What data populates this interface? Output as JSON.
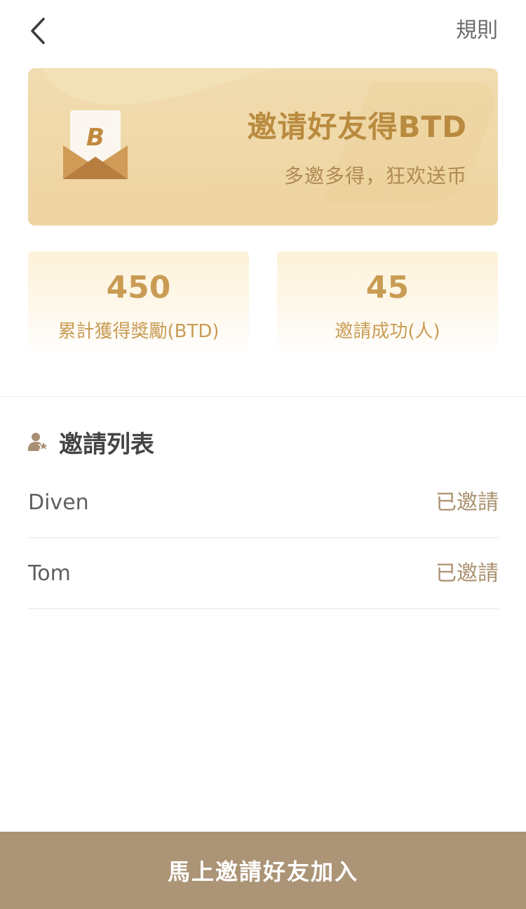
{
  "header": {
    "rules_label": "規則"
  },
  "banner": {
    "title": "邀请好友得BTD",
    "subtitle": "多邀多得，狂欢送币",
    "icon": "envelope-coin-icon"
  },
  "stats": [
    {
      "value": "450",
      "label": "累計獲得獎勵(BTD)"
    },
    {
      "value": "45",
      "label": "邀請成功(人)"
    }
  ],
  "invite_list": {
    "title": "邀請列表",
    "icon": "user-star-icon",
    "items": [
      {
        "name": "Diven",
        "status": "已邀請"
      },
      {
        "name": "Tom",
        "status": "已邀請"
      }
    ]
  },
  "cta": {
    "label": "馬上邀請好友加入"
  },
  "colors": {
    "accent": "#c99c54",
    "button": "#ac9477",
    "banner": "#f0d8a8"
  }
}
